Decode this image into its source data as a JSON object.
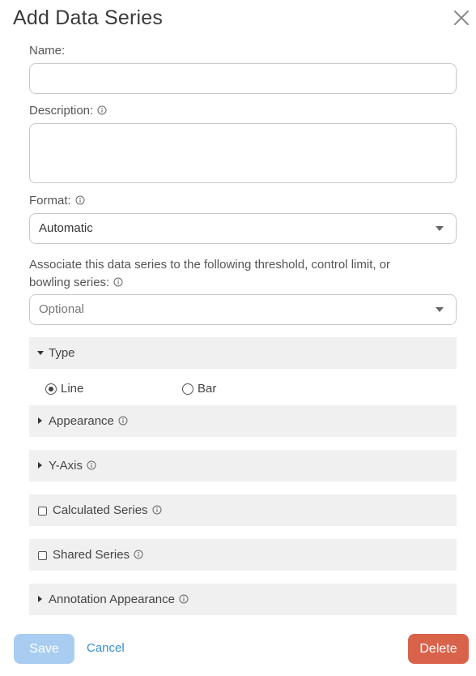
{
  "dialog": {
    "title": "Add Data Series"
  },
  "fields": {
    "name_label": "Name:",
    "name_value": "",
    "description_label": "Description:",
    "description_value": "",
    "format_label": "Format:",
    "format_value": "Automatic",
    "associate_label_line1": "Associate this data series to the following threshold, control limit, or",
    "associate_label_line2": "bowling series:",
    "associate_placeholder": "Optional"
  },
  "sections": {
    "type": {
      "label": "Type",
      "expanded": true
    },
    "type_options": [
      {
        "label": "Line",
        "selected": true
      },
      {
        "label": "Bar",
        "selected": false
      }
    ],
    "appearance": {
      "label": "Appearance"
    },
    "y_axis": {
      "label": "Y-Axis"
    },
    "calculated_series": {
      "label": "Calculated Series",
      "checked": false
    },
    "shared_series": {
      "label": "Shared Series",
      "checked": false
    },
    "annotation_appearance": {
      "label": "Annotation Appearance"
    }
  },
  "footer": {
    "save_label": "Save",
    "cancel_label": "Cancel",
    "delete_label": "Delete"
  },
  "colors": {
    "save_bg": "#a8cdf0",
    "cancel_text": "#3a8fd0",
    "delete_bg": "#d9624a",
    "section_bg": "#f0f0f0"
  },
  "icons": [
    "close-icon",
    "info-icon",
    "chevron-down-icon",
    "caret-right-icon",
    "caret-down-icon",
    "checkbox-icon",
    "radio-icon"
  ]
}
